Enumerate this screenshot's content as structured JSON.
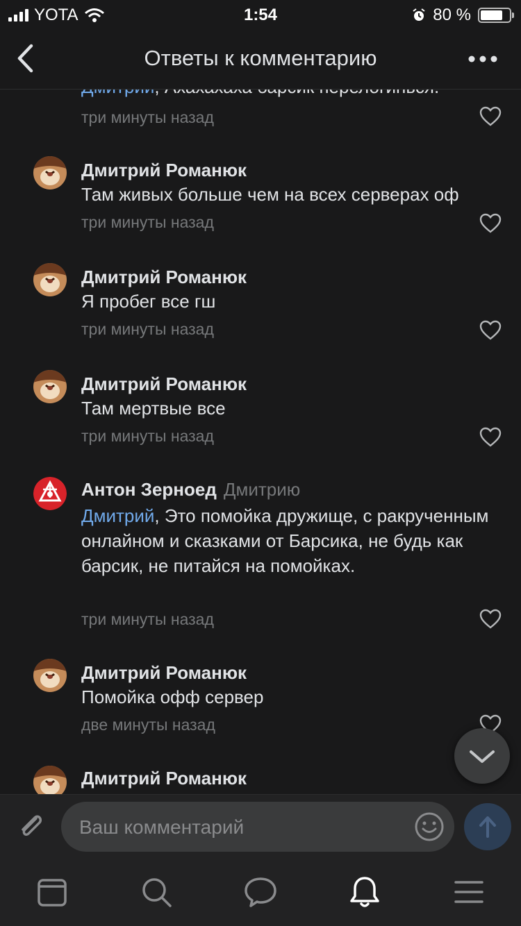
{
  "status": {
    "carrier": "YOTA",
    "time": "1:54",
    "battery": "80 %",
    "battery_level": 0.8
  },
  "header": {
    "title": "Ответы к комментарию"
  },
  "partial_comment": {
    "mention": "Дмитрий",
    "text": ", Ахахахаха барсик перелогинься.",
    "time": "три минуты назад"
  },
  "comments": [
    {
      "author": "Дмитрий Романюк",
      "text": "Там живых больше чем на всех серверах оф",
      "time": "три минуты назад"
    },
    {
      "author": "Дмитрий Романюк",
      "text": "Я пробег все гш",
      "time": "три минуты назад"
    },
    {
      "author": "Дмитрий Романюк",
      "text": "Там мертвые все",
      "time": "три минуты назад"
    },
    {
      "author": "Антон Зерноед",
      "reply_to": "Дмитрию",
      "mention": "Дмитрий",
      "text": ", Это помойка дружище, с ракрученным онлайном и сказками от Барсика, не будь как барсик, не питайся на помойках.",
      "time": "три минуты назад"
    },
    {
      "author": "Дмитрий Романюк",
      "text": "Помойка офф сервер",
      "time": "две минуты назад"
    },
    {
      "author": "Дмитрий Романюк"
    }
  ],
  "composer": {
    "placeholder": "Ваш комментарий"
  },
  "icons": {
    "back": "chevron-left-icon",
    "more": "more-horizontal-icon",
    "like": "heart-icon",
    "attach": "paperclip-icon",
    "emoji": "smile-icon",
    "send": "arrow-up-icon",
    "scroll_down": "chevron-down-icon",
    "tabs": [
      "news-icon",
      "search-icon",
      "messages-icon",
      "notifications-icon",
      "menu-icon"
    ]
  },
  "colors": {
    "background": "#19191a",
    "text": "#e1e3e6",
    "secondary": "#76787a",
    "link": "#71aaeb",
    "active_tab": "#ffffff",
    "inactive_tab": "#8a8b8d"
  }
}
